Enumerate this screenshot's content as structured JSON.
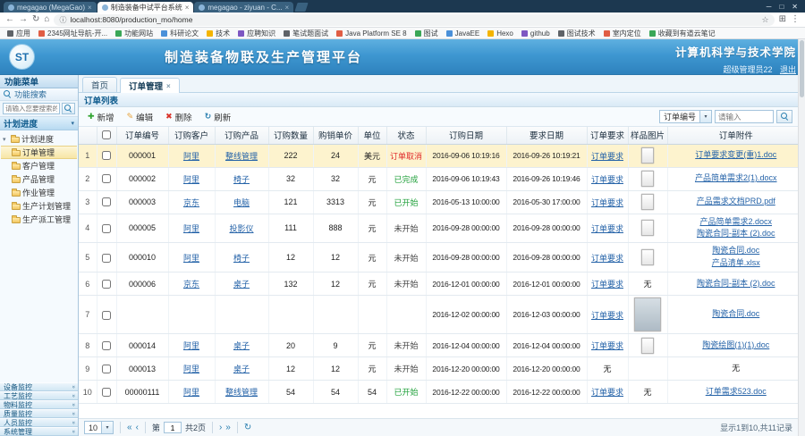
{
  "colors": {
    "accent": "#3287c8",
    "link": "#2563a8",
    "selected_row": "#fdf3ce",
    "status_cancel": "#e02b2b",
    "status_done": "#22a13c",
    "status_started": "#22a13c",
    "status_notstarted": "#444444"
  },
  "icons": {
    "close": "×",
    "window_close": "✕",
    "minimize": "─",
    "maximize": "□",
    "back": "←",
    "forward": "→",
    "reload": "↻",
    "home": "⌂",
    "info": "ⓘ",
    "star": "☆",
    "extension": "⊞",
    "menu": "⋮",
    "dropdown": "▾",
    "collapse": "»",
    "plus": "✚",
    "pencil": "✎",
    "delete": "✖",
    "refresh": "↻",
    "first": "«",
    "prev": "‹",
    "next": "›",
    "last": "»"
  },
  "browser": {
    "tabs": [
      {
        "label": "megagao (MegaGao)",
        "active": false
      },
      {
        "label": "制造装备中试平台系统",
        "active": true
      },
      {
        "label": "megagao - ziyuan - C...",
        "active": false
      }
    ],
    "url": "localhost:8080/production_mo/home",
    "bookmarks": [
      {
        "label": "应用",
        "icon": "apps-grid"
      },
      {
        "label": "2345网址导航-开...",
        "icon": "favicon"
      },
      {
        "label": "功能网站",
        "icon": "favicon"
      },
      {
        "label": "科研论文",
        "icon": "favicon"
      },
      {
        "label": "技术",
        "icon": "favicon"
      },
      {
        "label": "应聘知识",
        "icon": "favicon"
      },
      {
        "label": "笔试题面试",
        "icon": "favicon"
      },
      {
        "label": "Java Platform SE 8",
        "icon": "favicon"
      },
      {
        "label": "图试",
        "icon": "favicon"
      },
      {
        "label": "JavaEE",
        "icon": "favicon"
      },
      {
        "label": "Hexo",
        "icon": "favicon"
      },
      {
        "label": "github",
        "icon": "favicon"
      },
      {
        "label": "图试技术",
        "icon": "favicon"
      },
      {
        "label": "室内定位",
        "icon": "favicon"
      },
      {
        "label": "收藏到有道云笔记",
        "icon": "favicon"
      }
    ]
  },
  "header": {
    "logo_text": "ST",
    "title": "制造装备物联及生产管理平台",
    "college": "计算机科学与技术学院",
    "user": "超级管理员22",
    "logout": "退出"
  },
  "sidebar": {
    "menu_title": "功能菜单",
    "search_title": "功能搜索",
    "search_placeholder": "请输入您要搜索的功能",
    "accordion": "计划进度",
    "tree_root": "计划进度",
    "tree_items": [
      {
        "label": "订单管理",
        "selected": true
      },
      {
        "label": "客户管理"
      },
      {
        "label": "产品管理"
      },
      {
        "label": "作业管理"
      },
      {
        "label": "生产计划管理"
      },
      {
        "label": "生产派工管理"
      }
    ],
    "sections": [
      "设备监控",
      "工艺监控",
      "物料监控",
      "质量监控",
      "人员监控",
      "系统管理"
    ]
  },
  "main": {
    "tabs": [
      {
        "label": "首页",
        "active": false,
        "closable": false
      },
      {
        "label": "订单管理",
        "active": true,
        "closable": true
      }
    ],
    "panel_title": "订单列表",
    "toolbar": {
      "buttons": [
        {
          "label": "新增",
          "icon": "plus"
        },
        {
          "label": "编辑",
          "icon": "pencil"
        },
        {
          "label": "删除",
          "icon": "delete"
        },
        {
          "label": "刷新",
          "icon": "refresh"
        }
      ],
      "search_field": "订单编号",
      "search_placeholder": "请输入"
    },
    "table": {
      "columns": [
        "订单编号",
        "订购客户",
        "订购产品",
        "订购数量",
        "购销单价",
        "单位",
        "状态",
        "订购日期",
        "要求日期",
        "订单要求",
        "样品图片",
        "订单附件"
      ],
      "none_text": "无",
      "rows": [
        {
          "num": "1",
          "order_no": "000001",
          "customer": "阿里",
          "product": "整线管理",
          "qty": "222",
          "price": "24",
          "unit": "美元",
          "status": "订单取消",
          "status_color": "cancel",
          "order_date": "2016-09-06 10:19:16",
          "req_date": "2016-09-26 10:19:21",
          "requirement": "订单要求",
          "image": "thumb",
          "attachments": [
            "订单要求变更(重)1.doc"
          ],
          "selected": true
        },
        {
          "num": "2",
          "order_no": "000002",
          "customer": "阿里",
          "product": "椅子",
          "qty": "32",
          "price": "32",
          "unit": "元",
          "status": "已完成",
          "status_color": "done",
          "order_date": "2016-09-06 10:19:43",
          "req_date": "2016-09-26 10:19:46",
          "requirement": "订单要求",
          "image": "thumb",
          "attachments": [
            "产品简单需求2(1).docx"
          ]
        },
        {
          "num": "3",
          "order_no": "000003",
          "customer": "京东",
          "product": "电脑",
          "qty": "121",
          "price": "3313",
          "unit": "元",
          "status": "已开始",
          "status_color": "started",
          "order_date": "2016-05-13 10:00:00",
          "req_date": "2016-05-30 17:00:00",
          "requirement": "订单要求",
          "image": "thumb",
          "attachments": [
            "产品需求文档PRD.pdf"
          ]
        },
        {
          "num": "4",
          "order_no": "000005",
          "customer": "阿里",
          "product": "投影仪",
          "qty": "111",
          "price": "888",
          "unit": "元",
          "status": "未开始",
          "status_color": "notstarted",
          "order_date": "2016-09-28 00:00:00",
          "req_date": "2016-09-28 00:00:00",
          "requirement": "订单要求",
          "image": "thumb",
          "attachments": [
            "产品简单需求2.docx",
            "陶瓷合同-副本 (2).doc"
          ]
        },
        {
          "num": "5",
          "order_no": "000010",
          "customer": "阿里",
          "product": "椅子",
          "qty": "12",
          "price": "12",
          "unit": "元",
          "status": "未开始",
          "status_color": "notstarted",
          "order_date": "2016-09-28 00:00:00",
          "req_date": "2016-09-28 00:00:00",
          "requirement": "订单要求",
          "image": "thumb",
          "attachments": [
            "陶瓷合同.doc",
            "产品清单.xlsx"
          ]
        },
        {
          "num": "6",
          "order_no": "000006",
          "customer": "京东",
          "product": "桌子",
          "qty": "132",
          "price": "12",
          "unit": "元",
          "status": "未开始",
          "status_color": "notstarted",
          "order_date": "2016-12-01 00:00:00",
          "req_date": "2016-12-01 00:00:00",
          "requirement": "订单要求",
          "image": "none",
          "attachments": [
            "陶瓷合同-副本 (2).doc"
          ]
        },
        {
          "num": "7",
          "order_no": "",
          "customer": "",
          "product": "",
          "qty": "",
          "price": "",
          "unit": "",
          "status": "",
          "status_color": "",
          "order_date": "2016-12-02 00:00:00",
          "req_date": "2016-12-03 00:00:00",
          "requirement": "订单要求",
          "image": "thumb-large",
          "attachments": [
            "陶瓷合同.doc"
          ]
        },
        {
          "num": "8",
          "order_no": "000014",
          "customer": "阿里",
          "product": "桌子",
          "qty": "20",
          "price": "9",
          "unit": "元",
          "status": "未开始",
          "status_color": "notstarted",
          "order_date": "2016-12-04 00:00:00",
          "req_date": "2016-12-04 00:00:00",
          "requirement": "订单要求",
          "image": "thumb",
          "attachments": [
            "陶瓷绘图(1)(1).doc"
          ]
        },
        {
          "num": "9",
          "order_no": "000013",
          "customer": "阿里",
          "product": "桌子",
          "qty": "12",
          "price": "12",
          "unit": "元",
          "status": "未开始",
          "status_color": "notstarted",
          "order_date": "2016-12-20 00:00:00",
          "req_date": "2016-12-20 00:00:00",
          "requirement": "无",
          "image": "",
          "attachments": [
            "无"
          ]
        },
        {
          "num": "10",
          "order_no": "00000111",
          "customer": "阿里",
          "product": "整线管理",
          "qty": "54",
          "price": "54",
          "unit": "54",
          "status": "已开始",
          "status_color": "started",
          "order_date": "2016-12-22 00:00:00",
          "req_date": "2016-12-22 00:00:00",
          "requirement": "订单要求",
          "image": "none",
          "attachments": [
            "订单需求523.doc"
          ]
        }
      ]
    },
    "pagination": {
      "page_size": "10",
      "label_page": "第",
      "page_number": "1",
      "label_total": "共2页",
      "summary": "显示1到10,共11记录"
    }
  }
}
